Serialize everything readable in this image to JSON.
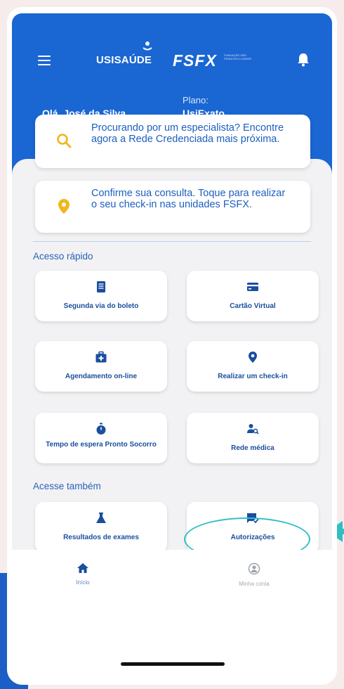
{
  "header": {
    "brand_left": "USISAÚDE",
    "brand_right": "FSFX",
    "brand_sub": "FUNDAÇÃO SÃO FRANCISCO XAVIER",
    "greeting": "Olá, José da Silva",
    "plan_label": "Plano:",
    "plan_value": "UsiExato"
  },
  "banners": [
    {
      "text": "Procurando por um especialista? Encontre agora a Rede Credenciada mais próxima.",
      "icon": "search-icon",
      "icon_color": "#f2b51b"
    },
    {
      "text": "Confirme sua consulta. Toque para realizar o seu check-in nas unidades FSFX.",
      "icon": "location-pin-icon",
      "icon_color": "#f2b51b"
    }
  ],
  "sections": {
    "quick_access": "Acesso rápido",
    "also_access": "Acesse também"
  },
  "quick_cards": [
    {
      "label": "Segunda via do boleto",
      "icon": "document-icon"
    },
    {
      "label": "Cartão Virtual",
      "icon": "card-icon"
    },
    {
      "label": "Agendamento on-line",
      "icon": "medical-bag-icon"
    },
    {
      "label": "Realizar um check-in",
      "icon": "location-pin-icon"
    },
    {
      "label": "Tempo de espera Pronto Socorro",
      "icon": "stopwatch-icon"
    },
    {
      "label": "Rede médica",
      "icon": "user-search-icon"
    }
  ],
  "also_cards": [
    {
      "label": "Resultados de exames",
      "icon": "flask-icon"
    },
    {
      "label": "Autorizações",
      "icon": "approval-icon"
    },
    {
      "label": "",
      "icon": "list-icon"
    },
    {
      "label": "",
      "icon": "headset-icon"
    }
  ],
  "bottom_nav": {
    "home": "Início",
    "account": "Minha conta"
  },
  "colors": {
    "primary": "#1a66d2",
    "accent": "#f2b51b",
    "highlight": "#2fbfc3",
    "card_text": "#1a4e9e"
  }
}
